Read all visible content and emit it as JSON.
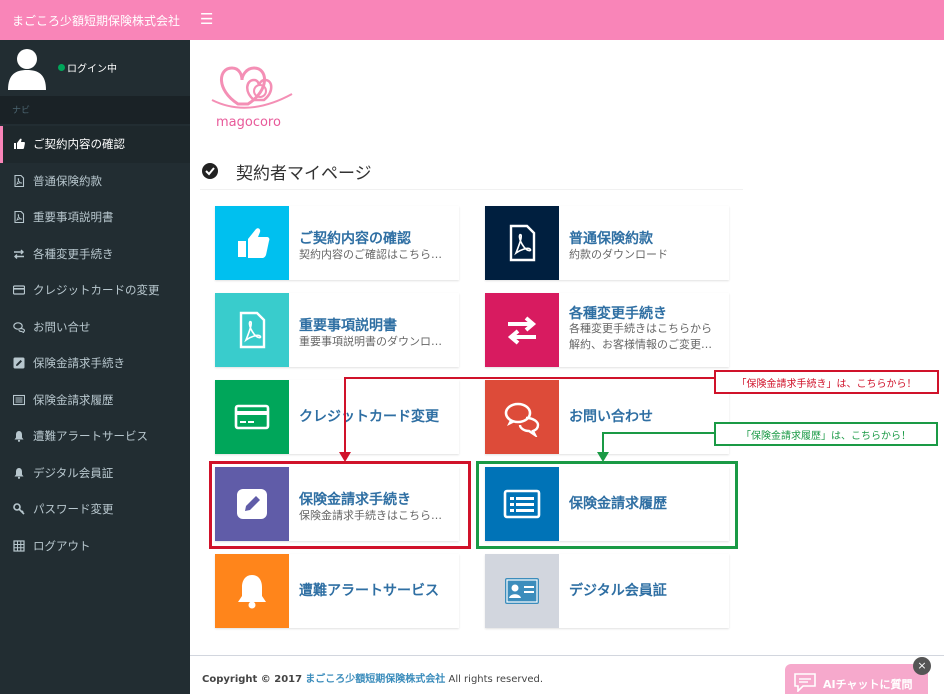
{
  "header": {
    "brand": "まごころ少額短期保険株式会社",
    "menu_icon": "hamburger-icon",
    "color": "#f985b8"
  },
  "sidebar": {
    "status": "ログイン中",
    "nav_header": "ナビ",
    "items": [
      {
        "label": "ご契約内容の確認",
        "icon": "hand-pointer-icon",
        "active": true
      },
      {
        "label": "普通保険約款",
        "icon": "pdf-file-icon"
      },
      {
        "label": "重要事項説明書",
        "icon": "pdf-file-icon"
      },
      {
        "label": "各種変更手続き",
        "icon": "exchange-icon"
      },
      {
        "label": "クレジットカードの変更",
        "icon": "credit-card-icon"
      },
      {
        "label": "お問い合せ",
        "icon": "comments-icon"
      },
      {
        "label": "保険金請求手続き",
        "icon": "edit-icon"
      },
      {
        "label": "保険金請求履歴",
        "icon": "list-icon"
      },
      {
        "label": "遭難アラートサービス",
        "icon": "bell-icon"
      },
      {
        "label": "デジタル会員証",
        "icon": "bell-icon"
      },
      {
        "label": "パスワード変更",
        "icon": "key-icon"
      },
      {
        "label": "ログアウト",
        "icon": "table-icon"
      }
    ]
  },
  "logo": {
    "text": "magocoro"
  },
  "main": {
    "title": "契約者マイページ",
    "cards": [
      {
        "title": "ご契約内容の確認",
        "desc": "契約内容のご確認はこちら…",
        "color": "#00c0ef",
        "icon": "hand-pointer-icon"
      },
      {
        "title": "普通保険約款",
        "desc": "約款のダウンロード",
        "color": "#001f3f",
        "icon": "pdf-file-icon"
      },
      {
        "title": "重要事項説明書",
        "desc": "重要事項説明書のダウンロ…",
        "color": "#39cccc",
        "icon": "pdf-file-icon"
      },
      {
        "title": "各種変更手続き",
        "desc": "各種変更手続きはこちらから",
        "desc2": "解約、お客様情報のご変更…",
        "color": "#d81b60",
        "icon": "exchange-icon"
      },
      {
        "title": "クレジットカード変更",
        "desc": "",
        "color": "#00a65a",
        "icon": "credit-card-icon"
      },
      {
        "title": "お問い合わせ",
        "desc": "",
        "color": "#dd4b39",
        "icon": "comments-icon"
      },
      {
        "title": "保険金請求手続き",
        "desc": "保険金請求手続きはこちら…",
        "color": "#605ca8",
        "icon": "edit-icon"
      },
      {
        "title": "保険金請求履歴",
        "desc": "",
        "color": "#0073b7",
        "icon": "list-icon"
      },
      {
        "title": "遭難アラートサービス",
        "desc": "",
        "color": "#ff851b",
        "icon": "bell-icon"
      },
      {
        "title": "デジタル会員証",
        "desc": "",
        "color": "#d2d6de",
        "icon": "id-card-icon"
      }
    ]
  },
  "annotations": {
    "red": "「保険金請求手続き」は、こちらから！",
    "green": "「保険金請求履歴」は、こちらから！",
    "red_color": "#d0122a",
    "green_color": "#1a9a45"
  },
  "footer": {
    "copyright": "Copyright © 2017",
    "company": "まごころ少額短期保険株式会社",
    "rights": "All rights reserved."
  },
  "chat": {
    "label": "AIチャットに質問",
    "close": "×"
  }
}
